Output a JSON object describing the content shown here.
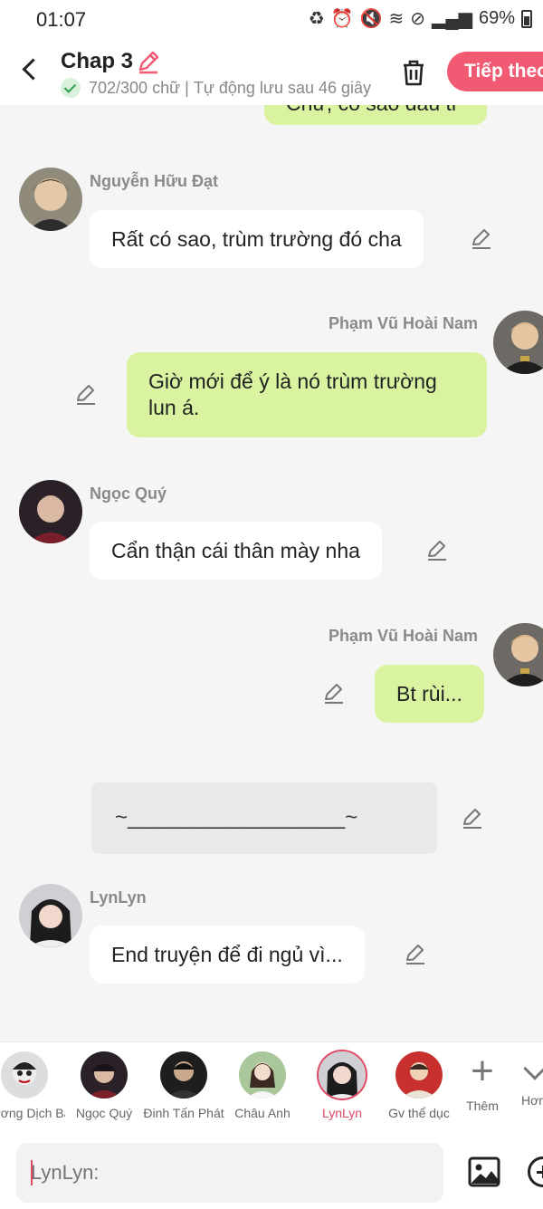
{
  "status_bar": {
    "time": "01:07",
    "battery": "69%"
  },
  "header": {
    "title": "Chap 3",
    "word_count": "702/300 chữ",
    "autosave": "Tự động lưu sau 46 giây",
    "next_label": "Tiếp theo"
  },
  "messages": [
    {
      "id": "m0",
      "side": "right",
      "sender": "",
      "text": "Chứ, có sao đâu tr"
    },
    {
      "id": "m1",
      "side": "left",
      "sender": "Nguyễn Hữu Đạt",
      "text": "Rất có sao, trùm trường đó cha"
    },
    {
      "id": "m2",
      "side": "right",
      "sender": "Phạm Vũ Hoài Nam",
      "text": "Giờ mới để ý là nó trùm trường lun á."
    },
    {
      "id": "m3",
      "side": "left",
      "sender": "Ngọc Quý",
      "text": "Cẩn thận cái thân mày nha"
    },
    {
      "id": "m4",
      "side": "right",
      "sender": "Phạm Vũ Hoài Nam",
      "text": "Bt rùi..."
    },
    {
      "id": "m5",
      "side": "system",
      "sender": "",
      "text": "~__________________~"
    },
    {
      "id": "m6",
      "side": "left",
      "sender": "LynLyn",
      "text": "End truyện để đi ngủ vì..."
    }
  ],
  "characters": [
    {
      "name": "Vương Dịch Bác",
      "active": false
    },
    {
      "name": "Ngọc Quý",
      "active": false
    },
    {
      "name": "Đinh Tấn Phát",
      "active": false
    },
    {
      "name": "Châu Anh",
      "active": false
    },
    {
      "name": "LynLyn",
      "active": true
    },
    {
      "name": "Gv thể dục",
      "active": false
    }
  ],
  "add_label": "Thêm",
  "more_label": "Hơn",
  "input": {
    "placeholder": "LynLyn:"
  },
  "colors": {
    "accent": "#f05a73",
    "right_bubble": "#d9f3a1",
    "left_bubble": "#ffffff",
    "active_char": "#e04864"
  }
}
